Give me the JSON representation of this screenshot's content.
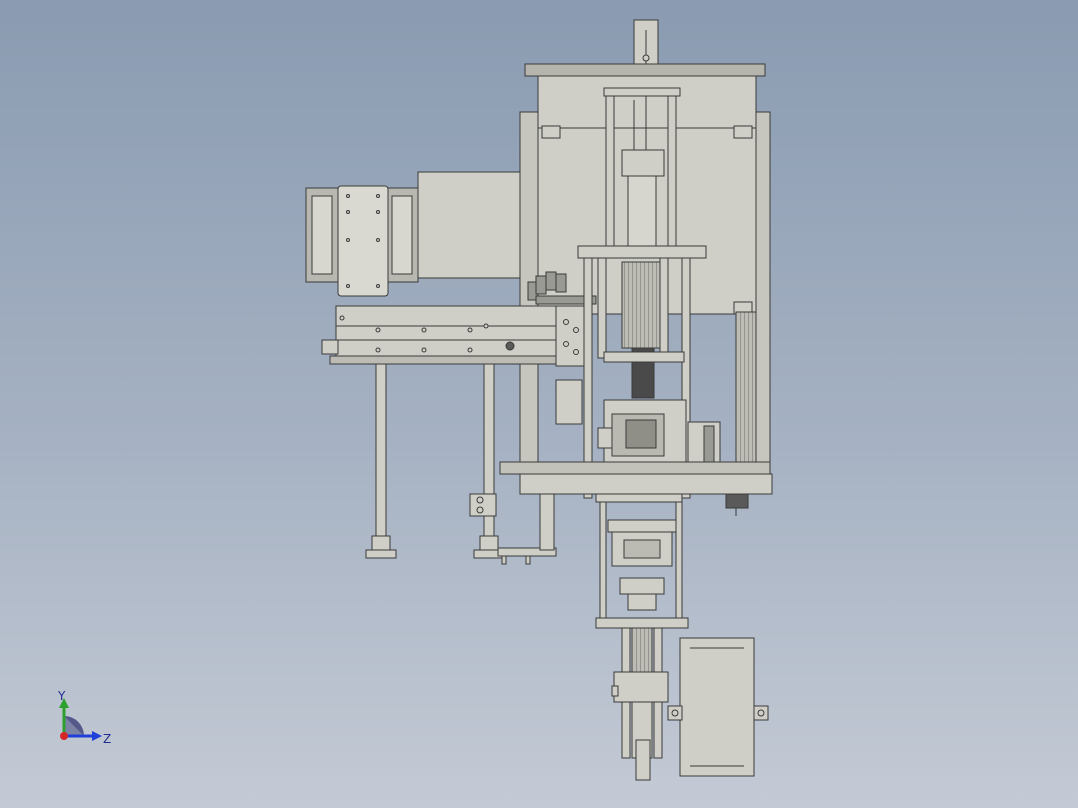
{
  "viewport": {
    "background_top": "#8a9bb1",
    "background_bottom": "#c4cad5"
  },
  "model": {
    "subject": "assembly-machine-drawing",
    "part_fill": "#cfcfc8",
    "part_stroke": "#3a3a3a",
    "dark_fill": "#4a4a4a"
  },
  "triad": {
    "y_label": "Y",
    "z_label": "Z",
    "y_color": "#2ca02c",
    "z_color": "#1f3fd8",
    "origin_color": "#d62728"
  }
}
